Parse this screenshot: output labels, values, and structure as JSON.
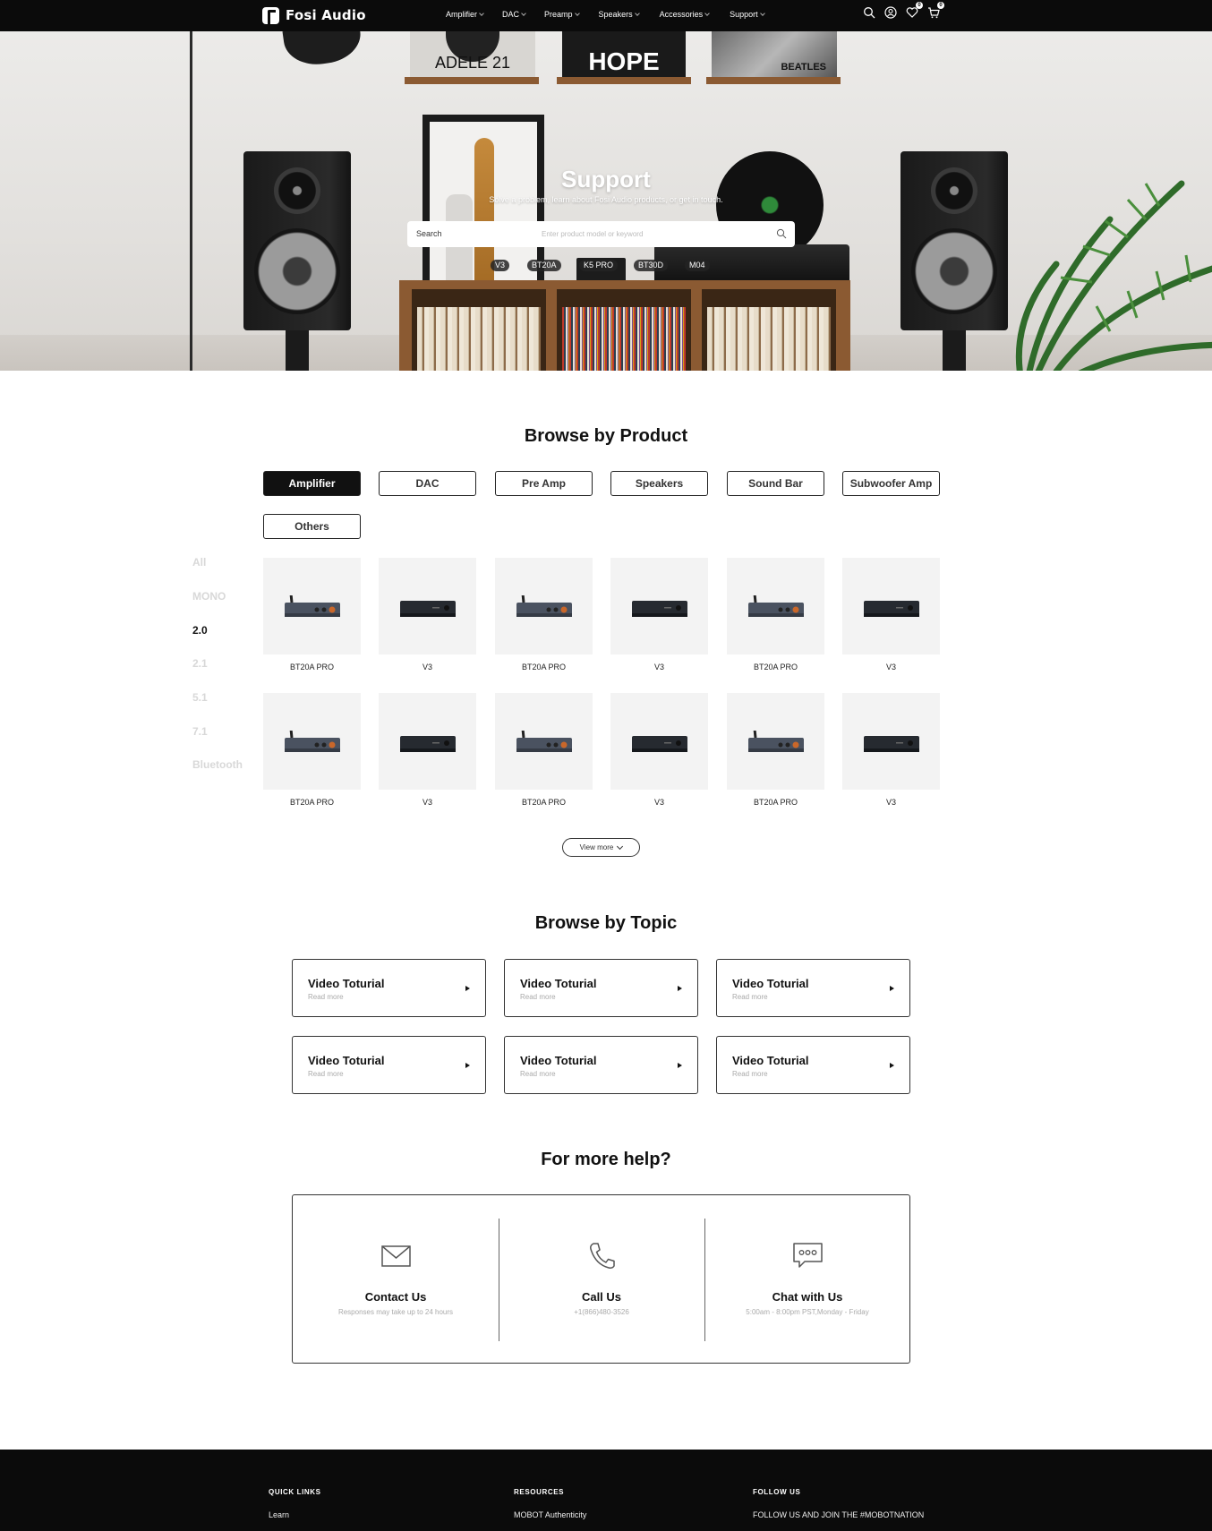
{
  "nav": {
    "brand": "Fosi Audio",
    "menu": [
      "Amplifier",
      "DAC",
      "Preamp",
      "Speakers",
      "Accessories",
      "Support"
    ],
    "wishlist_count": "0",
    "cart_count": "0"
  },
  "hero": {
    "title": "Support",
    "subtitle": "Solve a problem, learn about Fosi Audio products, or get in touch.",
    "search_label": "Search",
    "search_placeholder": "Enter product model or keyword",
    "tags": [
      "V3",
      "BT20A",
      "K5 PRO",
      "BT30D",
      "M04"
    ],
    "album_adele": "ADELE 21",
    "album_hope": "HOPE",
    "album_beatles": "BEATLES"
  },
  "browse_product": {
    "title": "Browse by Product",
    "categories": [
      "Amplifier",
      "DAC",
      "Pre Amp",
      "Speakers",
      "Sound Bar",
      "Subwoofer Amp",
      "Others"
    ],
    "active_category": "Amplifier",
    "filters": [
      "All",
      "MONO",
      "2.0",
      "2.1",
      "5.1",
      "7.1",
      "Bluetooth"
    ],
    "active_filter": "2.0",
    "products": [
      "BT20A PRO",
      "V3",
      "BT20A PRO",
      "V3",
      "BT20A PRO",
      "V3",
      "BT20A PRO",
      "V3",
      "BT20A PRO",
      "V3",
      "BT20A PRO",
      "V3"
    ],
    "view_more": "View more"
  },
  "browse_topic": {
    "title": "Browse by Topic",
    "topics": [
      {
        "title": "Video Toturial",
        "sub": "Read more"
      },
      {
        "title": "Video Toturial",
        "sub": "Read more"
      },
      {
        "title": "Video Toturial",
        "sub": "Read more"
      },
      {
        "title": "Video Toturial",
        "sub": "Read more"
      },
      {
        "title": "Video Toturial",
        "sub": "Read more"
      },
      {
        "title": "Video Toturial",
        "sub": "Read more"
      }
    ]
  },
  "help": {
    "title": "For more help?",
    "items": [
      {
        "title": "Contact Us",
        "sub": "Responses may take up to 24 hours",
        "icon": "mail-icon"
      },
      {
        "title": "Call Us",
        "sub": "+1(866)480-3526",
        "icon": "phone-icon"
      },
      {
        "title": "Chat with Us",
        "sub": "5:00am - 8:00pm PST,Monday - Friday",
        "icon": "chat-icon"
      }
    ]
  },
  "footer": {
    "quick_links": {
      "heading": "QUICK LINKS",
      "first": "Learn"
    },
    "resources": {
      "heading": "RESOURCES",
      "first": "MOBOT Authenticity"
    },
    "follow": {
      "heading": "FOLLOW US",
      "first": "FOLLOW US AND JOIN THE #MOBOTNATION"
    }
  },
  "colors": {
    "nav_bg": "#0b0b0b",
    "accent": "#111111",
    "muted": "#aaaaaa"
  }
}
